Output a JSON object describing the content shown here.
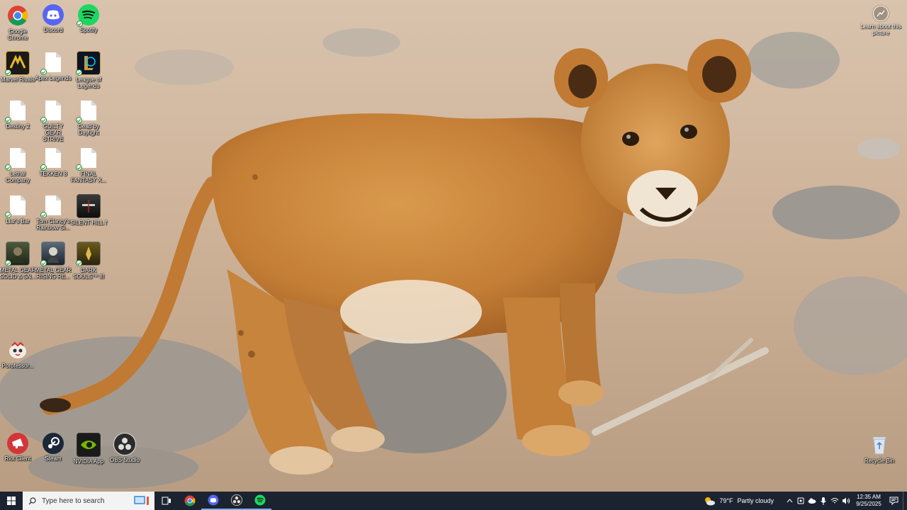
{
  "desktop": {
    "icons": [
      {
        "label": "Google Chrome",
        "icon": "chrome-icon"
      },
      {
        "label": "Discord",
        "icon": "discord-icon"
      },
      {
        "label": "Spotify",
        "icon": "spotify-icon"
      },
      {
        "label": "Marvel Rivals",
        "icon": "marvel-rivals-icon"
      },
      {
        "label": "Apex Legends",
        "icon": "document-icon"
      },
      {
        "label": "League of Legends",
        "icon": "league-of-legends-icon"
      },
      {
        "label": "Destiny 2",
        "icon": "document-icon"
      },
      {
        "label": "GUILTY GEAR STRIVE",
        "icon": "document-icon"
      },
      {
        "label": "Dead by Daylight",
        "icon": "document-icon"
      },
      {
        "label": "Lethal Company",
        "icon": "document-icon"
      },
      {
        "label": "TEKKEN 8",
        "icon": "document-icon"
      },
      {
        "label": "FINAL FANTASY X...",
        "icon": "document-icon"
      },
      {
        "label": "Liar's Bar",
        "icon": "document-icon"
      },
      {
        "label": "Tom Clancy's Rainbow Si...",
        "icon": "document-icon"
      },
      {
        "label": "SILENT HILL f",
        "icon": "silent-hill-icon"
      },
      {
        "label": "METAL GEAR SOLID Δ SN...",
        "icon": "mgs-delta-icon"
      },
      {
        "label": "METAL GEAR RISING RE...",
        "icon": "mg-rising-icon"
      },
      {
        "label": "DARK SOULS™ III",
        "icon": "dark-souls-icon"
      },
      {
        "label": "Porofessor...",
        "icon": "porofessor-icon"
      },
      {
        "label": "Riot Client",
        "icon": "riot-client-icon"
      },
      {
        "label": "Steam",
        "icon": "steam-icon"
      },
      {
        "label": "NVIDIA App",
        "icon": "nvidia-icon"
      },
      {
        "label": "OBS Studio",
        "icon": "obs-icon"
      },
      {
        "label": "Recycle Bin",
        "icon": "recycle-bin-icon"
      }
    ],
    "learn_about": "Learn about this picture"
  },
  "taskbar": {
    "search_placeholder": "Type here to search",
    "apps": [
      "task-view-icon",
      "chrome-icon",
      "discord-icon",
      "obs-icon",
      "spotify-icon"
    ],
    "weather": {
      "temp": "79°F",
      "condition": "Partly cloudy"
    },
    "clock": {
      "time": "12:35 AM",
      "date": "9/25/2025"
    }
  },
  "colors": {
    "taskbar": "#1c2330",
    "search_bg": "#f3f3f3",
    "chrome_red": "#db4437",
    "discord": "#5865f2",
    "spotify": "#1ed760",
    "nvidia": "#76b900",
    "riot": "#d13639"
  }
}
